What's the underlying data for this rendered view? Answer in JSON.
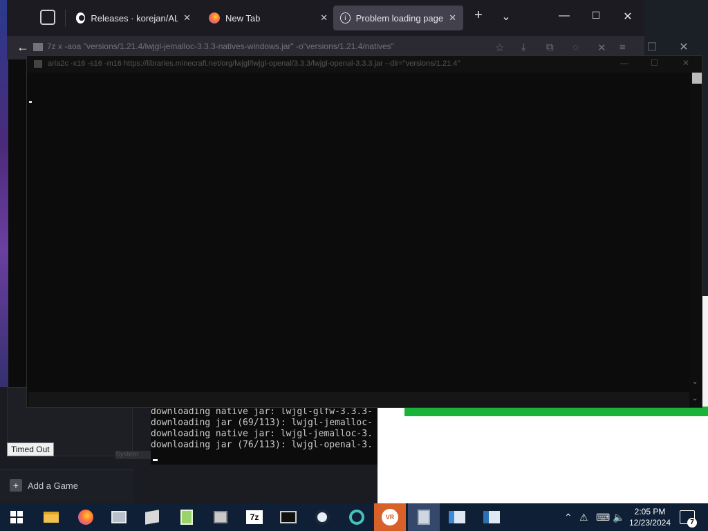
{
  "browser": {
    "tabs": [
      {
        "label": "Releases · korejan/ALXR-",
        "icon": "github-icon"
      },
      {
        "label": "New Tab",
        "icon": "firefox-icon"
      },
      {
        "label": "Problem loading page",
        "icon": "info-icon"
      }
    ],
    "new_tab": "+",
    "tab_list": "⌄"
  },
  "ghost_window": {
    "title": "7z  x  -aoa \"versions/1.21.4/lwjgl-jemalloc-3.3.3-natives-windows.jar\" -o\"versions/1.21.4/natives\""
  },
  "terminal": {
    "title": "aria2c  -x16 -s16 -m16 https://libraries.minecraft.net/org/lwjgl/lwjgl-openal/3.3.3/lwjgl-openal-3.3.3.jar --dir=\"versions/1.21.4\""
  },
  "console": {
    "lines": [
      "downloading native jar: lwjgl-glfw-3.3.3-",
      "downloading jar (69/113): lwjgl-jemalloc-",
      "downloading native jar: lwjgl-jemalloc-3.",
      "downloading jar (76/113): lwjgl-openal-3."
    ]
  },
  "steam": {
    "timed_out": "Timed Out",
    "add_game": "Add a Game",
    "cut_label": "System"
  },
  "taskbar": {
    "time": "2:05 PM",
    "date": "12/23/2024",
    "notification_count": "7",
    "sevenzip_label": "7z",
    "vr_label": "VR"
  },
  "colors": {
    "accent_orange": "#d8612a",
    "progress_green": "#19b33a",
    "taskbar": "#0f1f35"
  }
}
